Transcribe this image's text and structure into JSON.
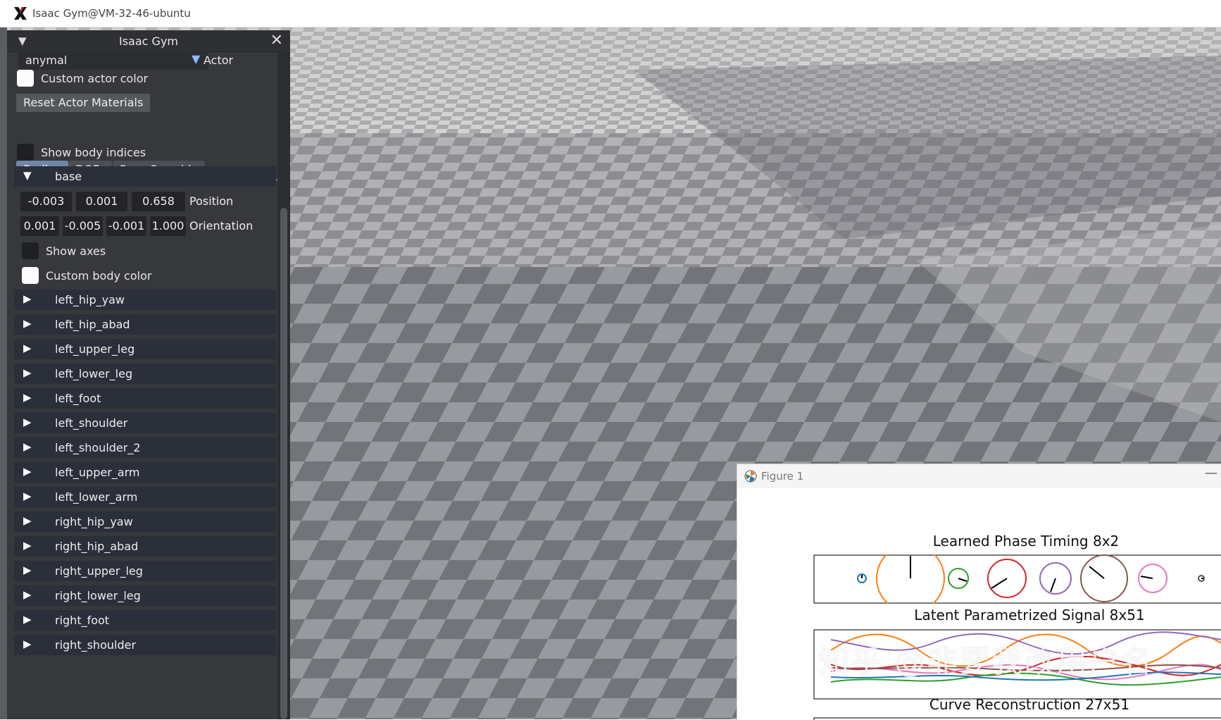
{
  "window": {
    "title": "Isaac Gym@VM-32-46-ubuntu"
  },
  "panel": {
    "title": "Isaac Gym",
    "actor_select": "anymal",
    "actor_label": "Actor",
    "custom_actor_color": "Custom actor color",
    "reset_materials": "Reset Actor Materials",
    "tabs": [
      "Bodies",
      "DOFs",
      "Pose Override"
    ],
    "show_body_indices": "Show body indices",
    "base": {
      "name": "base",
      "position": [
        "-0.003",
        "0.001",
        "0.658"
      ],
      "position_label": "Position",
      "orientation": [
        "0.001",
        "-0.005",
        "-0.001",
        "1.000"
      ],
      "orientation_label": "Orientation",
      "show_axes": "Show axes",
      "custom_body_color": "Custom body color"
    },
    "bodies": [
      "left_hip_yaw",
      "left_hip_abad",
      "left_upper_leg",
      "left_lower_leg",
      "left_foot",
      "left_shoulder",
      "left_shoulder_2",
      "left_upper_arm",
      "left_lower_arm",
      "right_hip_yaw",
      "right_hip_abad",
      "right_upper_leg",
      "right_lower_leg",
      "right_foot",
      "right_shoulder"
    ]
  },
  "figure": {
    "window_title": "Figure 1",
    "plot1_title": "Learned Phase Timing 8x2",
    "plot2_title": "Latent Parametrized Signal 8x51",
    "plot3_title": "Curve Reconstruction 27x51"
  },
  "watermark": "知乎 @非要我改用户名",
  "colors": {
    "panel_bg": "#36383b",
    "tab_active": "#6e87aa",
    "tree_bg": "#2a2f3a"
  }
}
